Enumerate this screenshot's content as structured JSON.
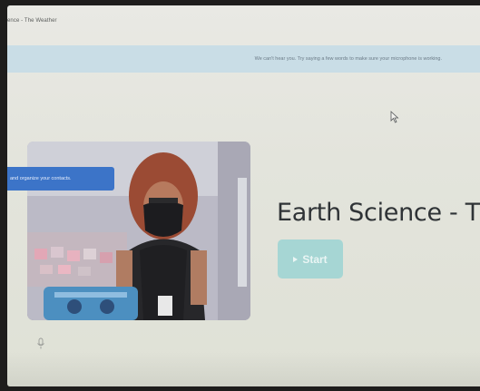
{
  "tab": {
    "title": "ence - The Weather"
  },
  "mic_banner": {
    "text": "We can't hear you. Try saying a few words to make sure your microphone is working."
  },
  "tooltip": {
    "text": "and organize your contacts."
  },
  "meeting": {
    "title": "Earth Science - The",
    "start_label": "Start"
  },
  "icons": {
    "cursor": "mouse-pointer-icon",
    "play": "play-icon",
    "microphone": "microphone-icon"
  },
  "colors": {
    "banner": "#c9dde6",
    "tooltip": "#3c74c8",
    "start_button": "#a6d6d4",
    "title_text": "#2f3336"
  }
}
